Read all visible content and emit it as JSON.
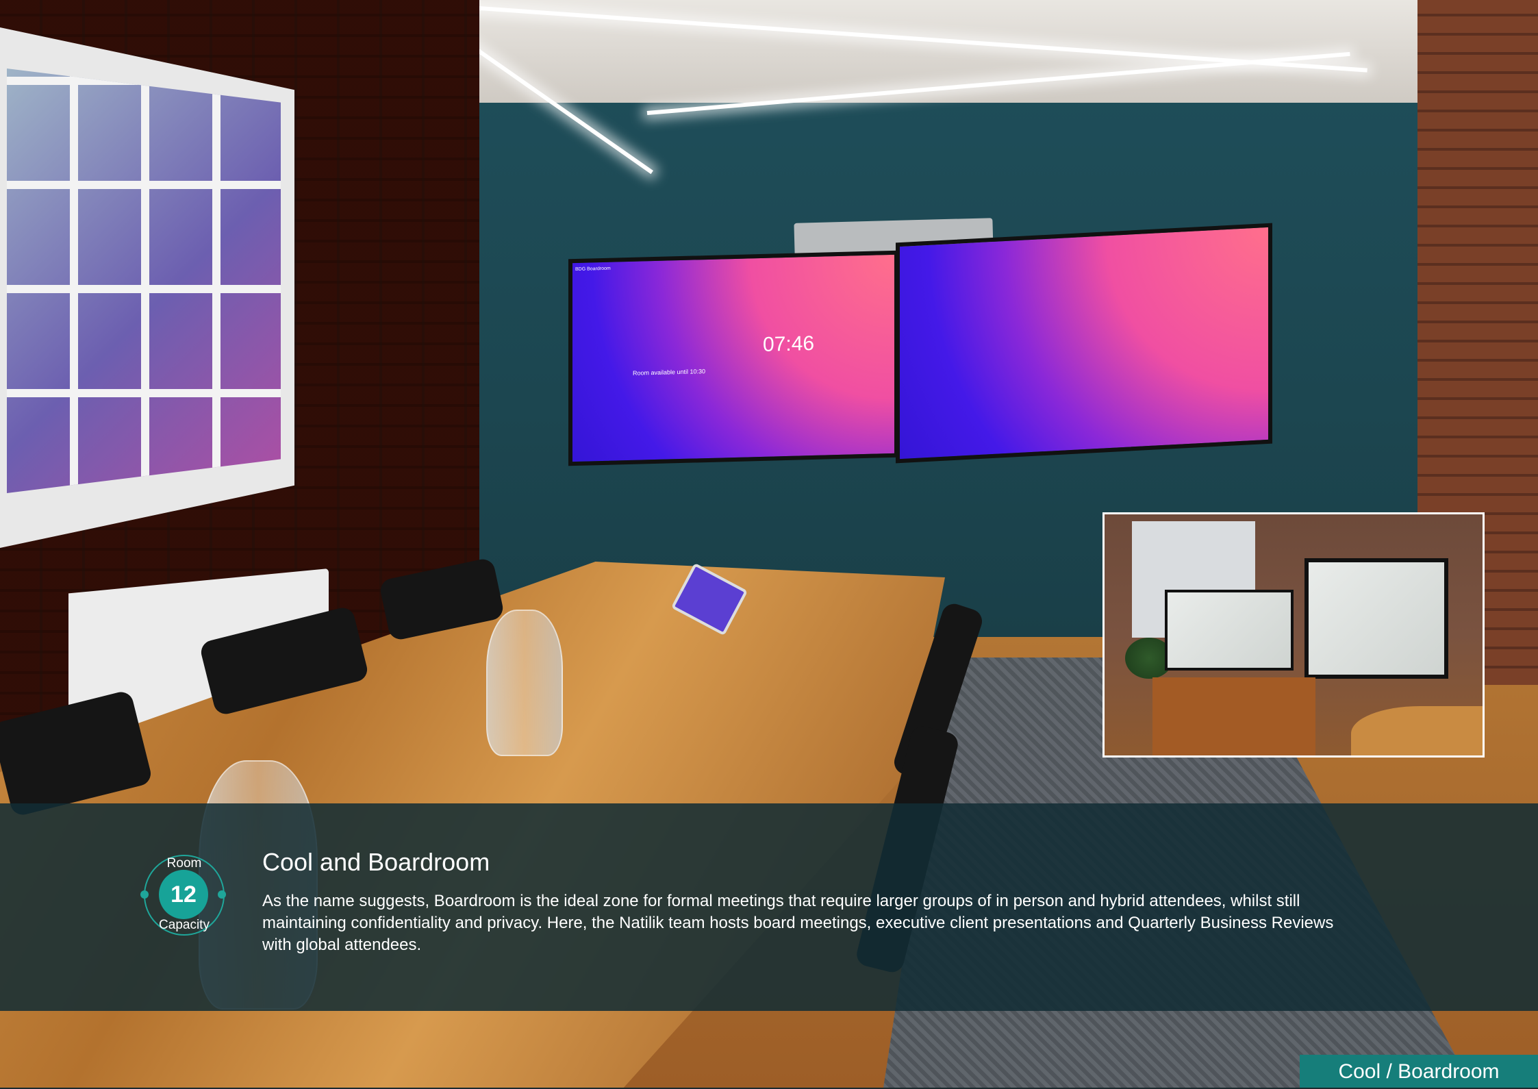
{
  "screen": {
    "clock": "07:46",
    "room_status": "Room available until 10:30",
    "room_label": "BDG Boardroom"
  },
  "panel": {
    "capacity_label_top": "Room",
    "capacity_value": "12",
    "capacity_label_bottom": "Capacity",
    "title": "Cool and Boardroom",
    "description": "As the name suggests, Boardroom is the ideal zone for formal meetings that require larger groups of in person and hybrid attendees, whilst still maintaining confidentiality and privacy. Here, the Natilik team hosts board meetings, executive client presentations and Quarterly Business Reviews with global attendees."
  },
  "footer": {
    "tag": "Cool / Boardroom"
  },
  "colors": {
    "overlay": "#122c34",
    "accent": "#17a398",
    "footer_tag": "#167e7a"
  }
}
